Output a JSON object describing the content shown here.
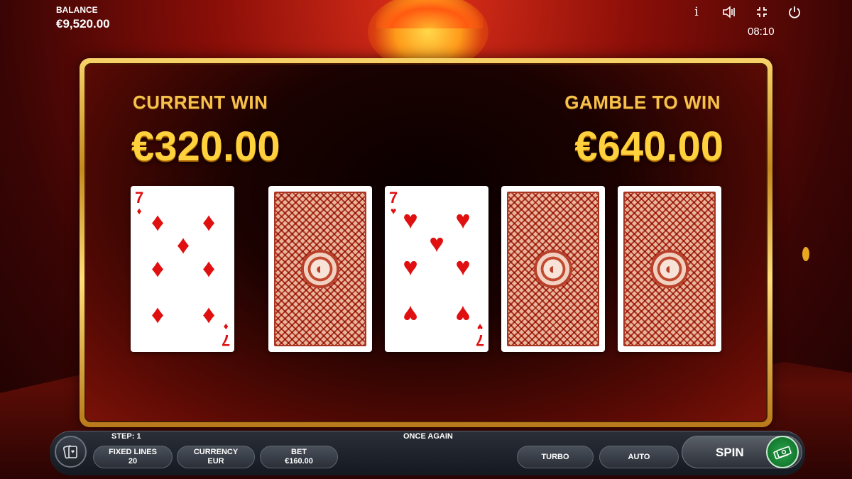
{
  "header": {
    "balance_label": "BALANCE",
    "balance_value": "€9,520.00",
    "clock": "08:10",
    "icons": [
      "info-icon",
      "sound-icon",
      "fullscreen-icon",
      "power-icon"
    ]
  },
  "gamble": {
    "current_win_label": "CURRENT WIN",
    "current_win_value": "€320.00",
    "gamble_label": "GAMBLE TO WIN",
    "gamble_value": "€640.00"
  },
  "cards": [
    {
      "face": "up",
      "rank": "7",
      "suit": "♦",
      "suit_name": "diamonds"
    },
    {
      "face": "down"
    },
    {
      "face": "up",
      "rank": "7",
      "suit": "♥",
      "suit_name": "hearts"
    },
    {
      "face": "down"
    },
    {
      "face": "down"
    }
  ],
  "bottom_bar": {
    "step": "STEP: 1",
    "message": "ONCE AGAIN",
    "fixed_lines_label": "FIXED LINES",
    "fixed_lines_value": "20",
    "currency_label": "CURRENCY",
    "currency_value": "EUR",
    "bet_label": "BET",
    "bet_value": "€160.00",
    "turbo_label": "TURBO",
    "auto_label": "AUTO",
    "spin_label": "SPIN"
  },
  "colors": {
    "gold": "#ffd23d",
    "card_red": "#e01010",
    "spin_green": "#137a30"
  }
}
